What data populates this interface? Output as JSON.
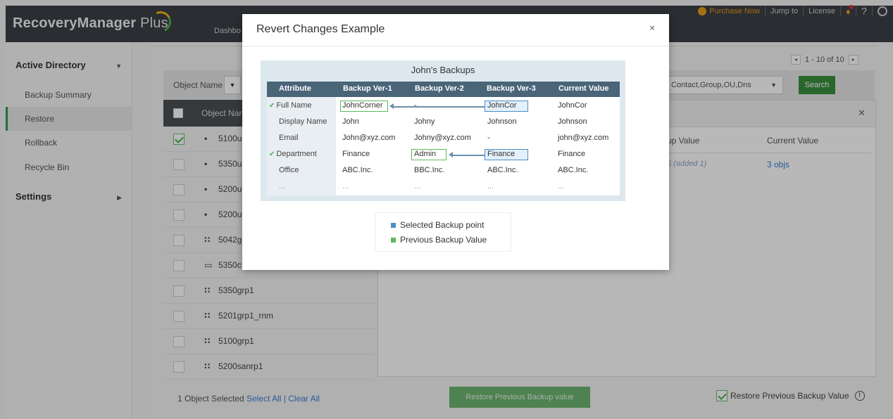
{
  "app": {
    "brand": "RecoveryManager",
    "brand_suffix": "Plus",
    "dash_tab": "Dashbo"
  },
  "topbar": {
    "purchase": "Purchase Now",
    "jump": "Jump to",
    "license": "License",
    "help": "?"
  },
  "sidebar": {
    "section1": "Active Directory",
    "items": [
      "Backup Summary",
      "Restore",
      "Rollback",
      "Recycle Bin"
    ],
    "section2": "Settings"
  },
  "pager": {
    "prev": "◂",
    "text": "1 - 10 of 10",
    "next": "▸"
  },
  "filter": {
    "label": "Object Name",
    "types": "Contact,Group,OU,Dns",
    "search": "Search"
  },
  "list": {
    "header": "Object Nar",
    "rows": [
      {
        "icon": "user-icon",
        "name": "5100u",
        "checked": true
      },
      {
        "icon": "user-icon",
        "name": "5350u",
        "checked": false
      },
      {
        "icon": "user-icon",
        "name": "5200u",
        "checked": false
      },
      {
        "icon": "user-icon",
        "name": "5200u",
        "checked": false
      },
      {
        "icon": "group-icon",
        "name": "5042g",
        "checked": false
      },
      {
        "icon": "computer-icon",
        "name": "5350c",
        "checked": false
      },
      {
        "icon": "group-icon",
        "name": "5350grp1",
        "checked": false
      },
      {
        "icon": "group-icon",
        "name": "5201grp1_rnm",
        "checked": false
      },
      {
        "icon": "group-icon",
        "name": "5100grp1",
        "checked": false
      },
      {
        "icon": "group-icon",
        "name": "5200sanrp1",
        "checked": false
      }
    ],
    "selected_text": "1 Object Selected",
    "select_all": "Select All",
    "divider": "|",
    "clear_all": "Clear All"
  },
  "right_panel": {
    "col_backup": "up Value",
    "col_current": "Current Value",
    "added": "5 (added 1)",
    "objs": "3 objs"
  },
  "actions": {
    "restore_button": "Restore Previous Backup value",
    "restore_check": "Restore Previous Backup Value",
    "info": "!"
  },
  "modal": {
    "title": "Revert Changes Example",
    "close": "×",
    "example_title": "John's Backups",
    "headers": [
      "Attribute",
      "Backup Ver-1",
      "Backup Ver-2",
      "Backup Ver-3",
      "Current Value"
    ],
    "rows": [
      {
        "attr": "Full Name",
        "checked": true,
        "v1": "JohnCorner",
        "v2": "-",
        "v3": "JohnCor",
        "cur": "JohnCor"
      },
      {
        "attr": "Display Name",
        "checked": false,
        "v1": "John",
        "v2": "Johny",
        "v3": "Johnson",
        "cur": "Johnson"
      },
      {
        "attr": "Email",
        "checked": false,
        "v1": "John@xyz.com",
        "v2": "Johny@xyz.com",
        "v3": "-",
        "cur": "john@xyz.com"
      },
      {
        "attr": "Department",
        "checked": true,
        "v1": "Finance",
        "v2": "Admin",
        "v3": "Finance",
        "cur": "Finance"
      },
      {
        "attr": "Office",
        "checked": false,
        "v1": "ABC.Inc.",
        "v2": "BBC.Inc.",
        "v3": "ABC.Inc.",
        "cur": "ABC.Inc."
      },
      {
        "attr": "...",
        "checked": false,
        "v1": "...",
        "v2": "...",
        "v3": "...",
        "cur": "..."
      }
    ],
    "legend_selected": "Selected Backup point",
    "legend_previous": "Previous Backup Value",
    "colors": {
      "selected": "#4a8fc8",
      "previous": "#5cb85c",
      "header": "#4a6478"
    }
  }
}
